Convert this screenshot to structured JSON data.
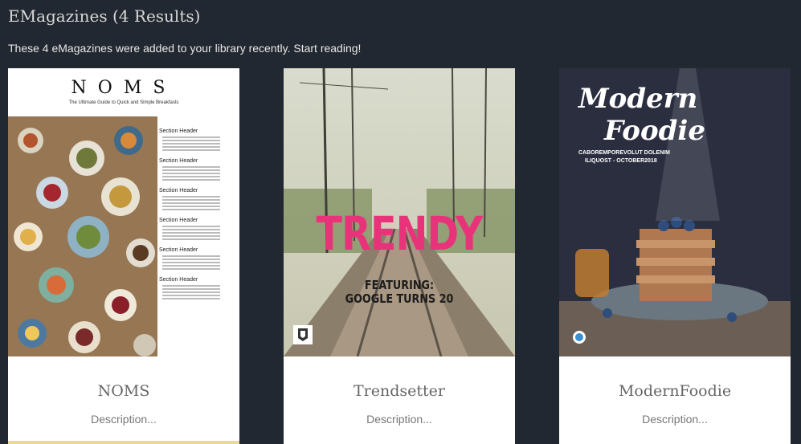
{
  "header": {
    "title": "EMagazines (4 Results)",
    "subtitle": "These 4 eMagazines were added to your library recently. Start reading!"
  },
  "magazines": [
    {
      "title": "NOMS",
      "description": "Description...",
      "cover": {
        "logo": "NOMS",
        "tagline": "The Ultimate Guide to Quick and Simple Breakfasts",
        "section_header": "Section Header"
      }
    },
    {
      "title": "Trendsetter",
      "description": "Description...",
      "cover": {
        "headline": "TRENDY",
        "featuring_line1": "FEATURING:",
        "featuring_line2": "GOOGLE TURNS 20"
      }
    },
    {
      "title": "ModernFoodie",
      "description": "Description...",
      "cover": {
        "title_line1": "Modern",
        "title_line2": "Foodie",
        "subline1": "CABOREMPOREVOLUT DOLENIM",
        "subline2": "ILIQUOST - OCTOBER2018"
      }
    }
  ],
  "colors": {
    "background": "#222831",
    "card": "#ffffff",
    "trendy_pink": "#e8337a"
  }
}
